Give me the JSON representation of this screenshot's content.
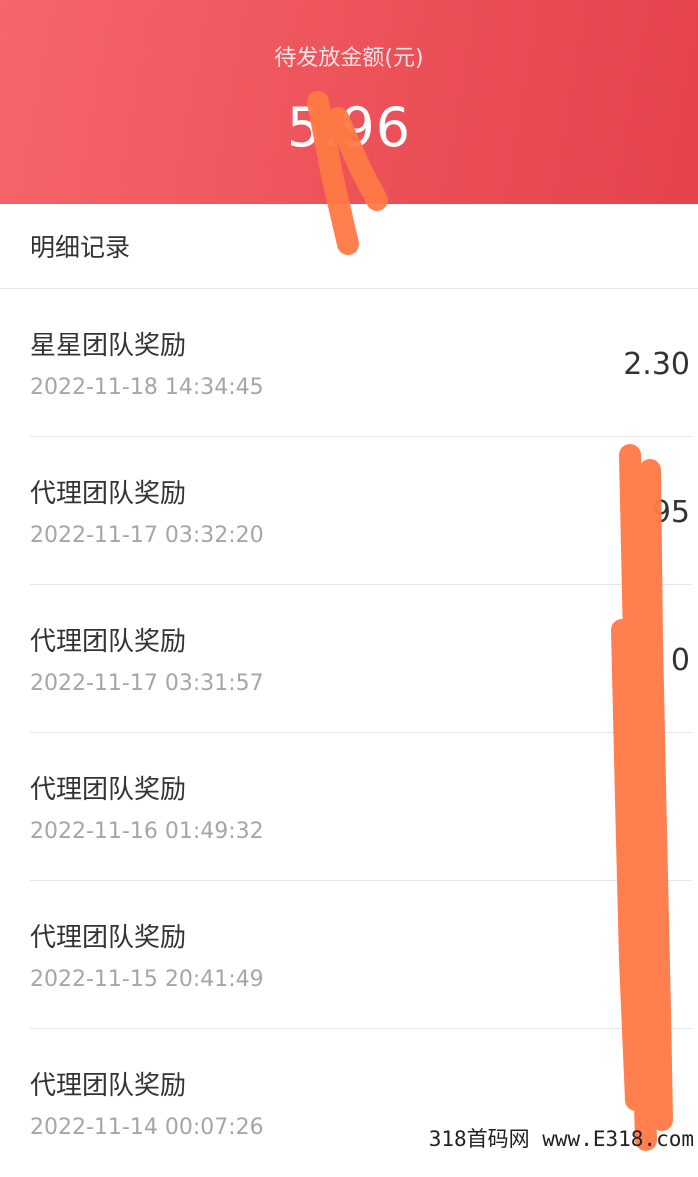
{
  "header": {
    "label": "待发放金额(元)",
    "amount": "5.96"
  },
  "section": {
    "title": "明细记录"
  },
  "records": [
    {
      "title": "星星团队奖励",
      "time": "2022-11-18 14:34:45",
      "amount": "2.30"
    },
    {
      "title": "代理团队奖励",
      "time": "2022-11-17 03:32:20",
      "amount": "95"
    },
    {
      "title": "代理团队奖励",
      "time": "2022-11-17 03:31:57",
      "amount": "0"
    },
    {
      "title": "代理团队奖励",
      "time": "2022-11-16 01:49:32",
      "amount": ""
    },
    {
      "title": "代理团队奖励",
      "time": "2022-11-15 20:41:49",
      "amount": ""
    },
    {
      "title": "代理团队奖励",
      "time": "2022-11-14 00:07:26",
      "amount": ""
    }
  ],
  "watermark": "318首码网 www.E318.com",
  "colors": {
    "header": "#ec5158",
    "scribble": "#ff7a45"
  }
}
